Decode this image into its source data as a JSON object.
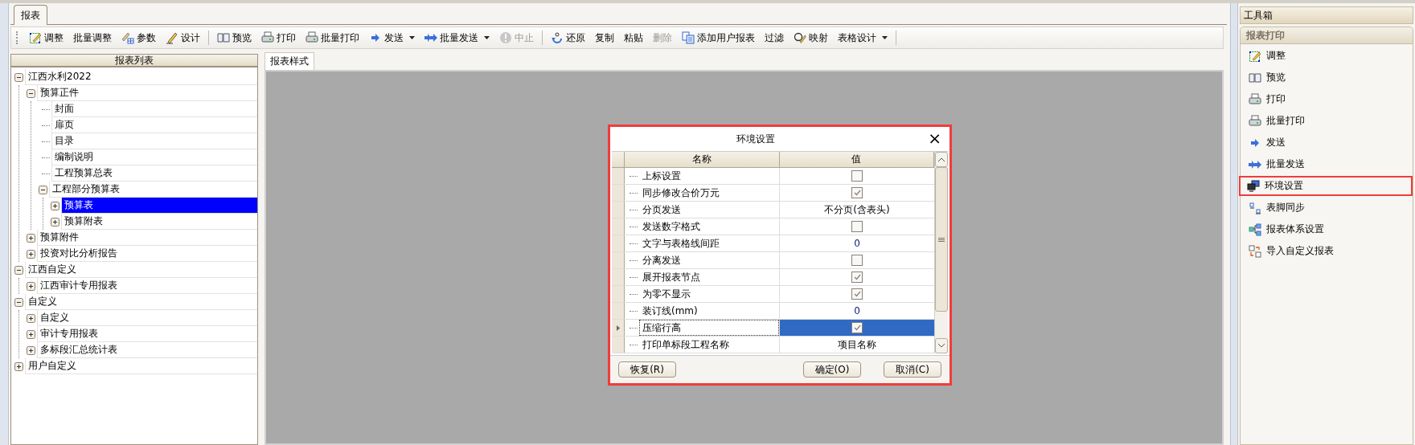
{
  "tabs": [
    {
      "label": "报表",
      "selected": true
    }
  ],
  "toolbar": [
    {
      "kind": "button",
      "label": "调整",
      "disabled": false,
      "has_menu": false
    },
    {
      "kind": "button",
      "label": "批量调整",
      "disabled": false,
      "has_menu": false
    },
    {
      "kind": "button",
      "label": "参数",
      "disabled": false,
      "has_menu": false
    },
    {
      "kind": "button",
      "label": "设计",
      "disabled": false,
      "has_menu": false
    },
    {
      "kind": "separator"
    },
    {
      "kind": "button",
      "label": "预览",
      "disabled": false,
      "has_menu": false
    },
    {
      "kind": "button",
      "label": "打印",
      "disabled": false,
      "has_menu": false
    },
    {
      "kind": "button",
      "label": "批量打印",
      "disabled": false,
      "has_menu": false
    },
    {
      "kind": "button",
      "label": "发送",
      "disabled": false,
      "has_menu": true
    },
    {
      "kind": "button",
      "label": "批量发送",
      "disabled": false,
      "has_menu": true
    },
    {
      "kind": "button",
      "label": "中止",
      "disabled": true,
      "has_menu": false
    },
    {
      "kind": "separator"
    },
    {
      "kind": "button",
      "label": "还原",
      "disabled": false,
      "has_menu": false
    },
    {
      "kind": "button",
      "label": "复制",
      "disabled": false,
      "has_menu": false
    },
    {
      "kind": "button",
      "label": "粘贴",
      "disabled": false,
      "has_menu": false
    },
    {
      "kind": "button",
      "label": "删除",
      "disabled": true,
      "has_menu": false
    },
    {
      "kind": "button",
      "label": "添加用户报表",
      "disabled": false,
      "has_menu": false
    },
    {
      "kind": "button",
      "label": "过滤",
      "disabled": false,
      "has_menu": false
    },
    {
      "kind": "button",
      "label": "映射",
      "disabled": false,
      "has_menu": false
    },
    {
      "kind": "button",
      "label": "表格设计",
      "disabled": false,
      "has_menu": true
    },
    {
      "kind": "separator"
    }
  ],
  "report_list": {
    "title": "报表列表",
    "items": [
      {
        "label": "江西水利2022",
        "expanded": true,
        "selected": false,
        "children": [
          {
            "label": "预算正件",
            "expanded": true,
            "selected": false,
            "children": [
              {
                "label": "封面",
                "selected": false
              },
              {
                "label": "扉页",
                "selected": false
              },
              {
                "label": "目录",
                "selected": false
              },
              {
                "label": "编制说明",
                "selected": false
              },
              {
                "label": "工程预算总表",
                "selected": false
              },
              {
                "label": "工程部分预算表",
                "expanded": true,
                "selected": false,
                "children": [
                  {
                    "label": "预算表",
                    "expanded": false,
                    "selected": true
                  },
                  {
                    "label": "预算附表",
                    "expanded": false,
                    "selected": false
                  }
                ]
              }
            ]
          },
          {
            "label": "预算附件",
            "expanded": false,
            "selected": false
          },
          {
            "label": "投资对比分析报告",
            "expanded": false,
            "selected": false
          }
        ]
      },
      {
        "label": "江西自定义",
        "expanded": true,
        "selected": false,
        "children": [
          {
            "label": "江西审计专用报表",
            "expanded": false,
            "selected": false
          }
        ]
      },
      {
        "label": "自定义",
        "expanded": true,
        "selected": false,
        "children": [
          {
            "label": "自定义",
            "expanded": false,
            "selected": false
          },
          {
            "label": "审计专用报表",
            "expanded": false,
            "selected": false
          },
          {
            "label": "多标段汇总统计表",
            "expanded": false,
            "selected": false
          }
        ]
      },
      {
        "label": "用户自定义",
        "expanded": false,
        "selected": false
      }
    ]
  },
  "preview": {
    "tabs": [
      {
        "label": "报表样式",
        "selected": true
      }
    ]
  },
  "dialog": {
    "title": "环境设置",
    "close": "×",
    "highlighted": true,
    "columns": [
      "名称",
      "值"
    ],
    "rows": [
      {
        "name": "上标设置",
        "kind": "checkbox",
        "checked": false,
        "selected": false
      },
      {
        "name": "同步修改合价万元",
        "kind": "checkbox",
        "checked": true,
        "selected": false
      },
      {
        "name": "分页发送",
        "kind": "text",
        "value": "不分页(含表头)",
        "selected": false
      },
      {
        "name": "发送数字格式",
        "kind": "checkbox",
        "checked": false,
        "selected": false
      },
      {
        "name": "文字与表格线间距",
        "kind": "text",
        "value": "0",
        "selected": false
      },
      {
        "name": "分离发送",
        "kind": "checkbox",
        "checked": false,
        "selected": false
      },
      {
        "name": "展开报表节点",
        "kind": "checkbox",
        "checked": true,
        "selected": false
      },
      {
        "name": "为零不显示",
        "kind": "checkbox",
        "checked": true,
        "selected": false
      },
      {
        "name": "装订线(mm)",
        "kind": "text",
        "value": "0",
        "selected": false
      },
      {
        "name": "压缩行高",
        "kind": "checkbox",
        "checked": true,
        "selected": true
      },
      {
        "name": "打印单标段工程名称",
        "kind": "text",
        "value": "项目名称",
        "selected": false
      }
    ],
    "buttons": [
      "恢复(R)",
      "确定(O)",
      "取消(C)"
    ]
  },
  "toolbox": {
    "title": "工具箱",
    "group": "报表打印",
    "items": [
      {
        "label": "调整",
        "highlighted": false
      },
      {
        "label": "预览",
        "highlighted": false
      },
      {
        "label": "打印",
        "highlighted": false
      },
      {
        "label": "批量打印",
        "highlighted": false
      },
      {
        "label": "发送",
        "highlighted": false
      },
      {
        "label": "批量发送",
        "highlighted": false
      },
      {
        "label": "环境设置",
        "highlighted": true
      },
      {
        "label": "表脚同步",
        "highlighted": false
      },
      {
        "label": "报表体系设置",
        "highlighted": false
      },
      {
        "label": "导入自定义报表",
        "highlighted": false
      }
    ]
  }
}
